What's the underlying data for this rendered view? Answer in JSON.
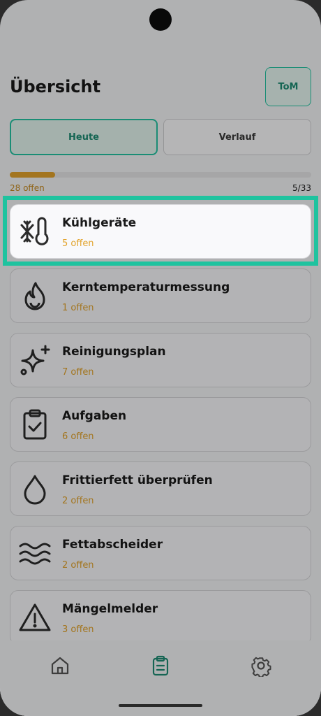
{
  "header": {
    "title": "Übersicht",
    "avatar_initials": "ToM"
  },
  "segments": [
    {
      "label": "Heute",
      "active": true
    },
    {
      "label": "Verlauf",
      "active": false
    }
  ],
  "progress": {
    "open_label": "28 offen",
    "count_label": "5/33",
    "fraction": 0.1515
  },
  "categories": [
    {
      "label": "Kühlgeräte",
      "sub": "5 offen",
      "icon": "snowflake-thermometer-icon",
      "highlighted": true
    },
    {
      "label": "Kerntemperaturmessung",
      "sub": "1 offen",
      "icon": "flame-icon"
    },
    {
      "label": "Reinigungsplan",
      "sub": "7 offen",
      "icon": "sparkle-icon"
    },
    {
      "label": "Aufgaben",
      "sub": "6 offen",
      "icon": "clipboard-check-icon"
    },
    {
      "label": "Frittierfett überprüfen",
      "sub": "2 offen",
      "icon": "drop-icon"
    },
    {
      "label": "Fettabscheider",
      "sub": "2 offen",
      "icon": "waves-icon"
    },
    {
      "label": "Mängelmelder",
      "sub": "3 offen",
      "icon": "warning-triangle-icon"
    }
  ],
  "nav": [
    {
      "icon": "home-icon",
      "active": false
    },
    {
      "icon": "clipboard-list-icon",
      "active": true
    },
    {
      "icon": "gear-icon",
      "active": false
    }
  ],
  "colors": {
    "accent": "#25c4a2",
    "warning": "#e2a32b",
    "highlight_frame": "#1fc39f"
  }
}
